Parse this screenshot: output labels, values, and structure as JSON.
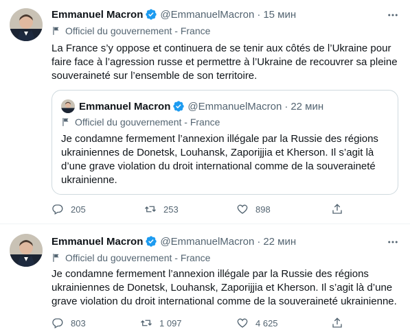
{
  "tweets": [
    {
      "author": {
        "name": "Emmanuel Macron",
        "handle": "@EmmanuelMacron",
        "verified": true
      },
      "time": "15 мин",
      "label": "Officiel du gouvernement - France",
      "text_lines": [
        "La France s’y oppose et continuera de se tenir aux côtés de l’Ukraine pour",
        "faire face à l’agression russe et permettre à l’Ukraine de recouvrer sa pleine",
        "souveraineté sur l’ensemble de son territoire."
      ],
      "quote": {
        "author": {
          "name": "Emmanuel Macron",
          "handle": "@EmmanuelMacron",
          "verified": true
        },
        "time": "22 мин",
        "label": "Officiel du gouvernement - France",
        "text_lines": [
          "Je condamne fermement l’annexion illégale par la Russie des régions",
          "ukrainiennes de Donetsk, Louhansk, Zaporijjia et Kherson. Il s’agit là",
          "d’une grave violation du droit international comme de la souveraineté",
          "ukrainienne."
        ]
      },
      "metrics": {
        "replies": "205",
        "retweets": "253",
        "likes": "898"
      }
    },
    {
      "author": {
        "name": "Emmanuel Macron",
        "handle": "@EmmanuelMacron",
        "verified": true
      },
      "time": "22 мин",
      "label": "Officiel du gouvernement - France",
      "text_lines": [
        "Je condamne fermement l’annexion illégale par la Russie des régions",
        "ukrainiennes de Donetsk, Louhansk, Zaporijjia et Kherson. Il s’agit là d’une",
        "grave violation du droit international comme de la souveraineté ukrainienne."
      ],
      "metrics": {
        "replies": "803",
        "retweets": "1 097",
        "likes": "4 625"
      }
    }
  ],
  "colors": {
    "accent": "#1d9bf0",
    "muted": "#536471",
    "border": "#cfd9de"
  },
  "icons": [
    "more-icon",
    "verified-icon",
    "flag-icon",
    "reply-icon",
    "retweet-icon",
    "like-icon",
    "share-icon"
  ]
}
